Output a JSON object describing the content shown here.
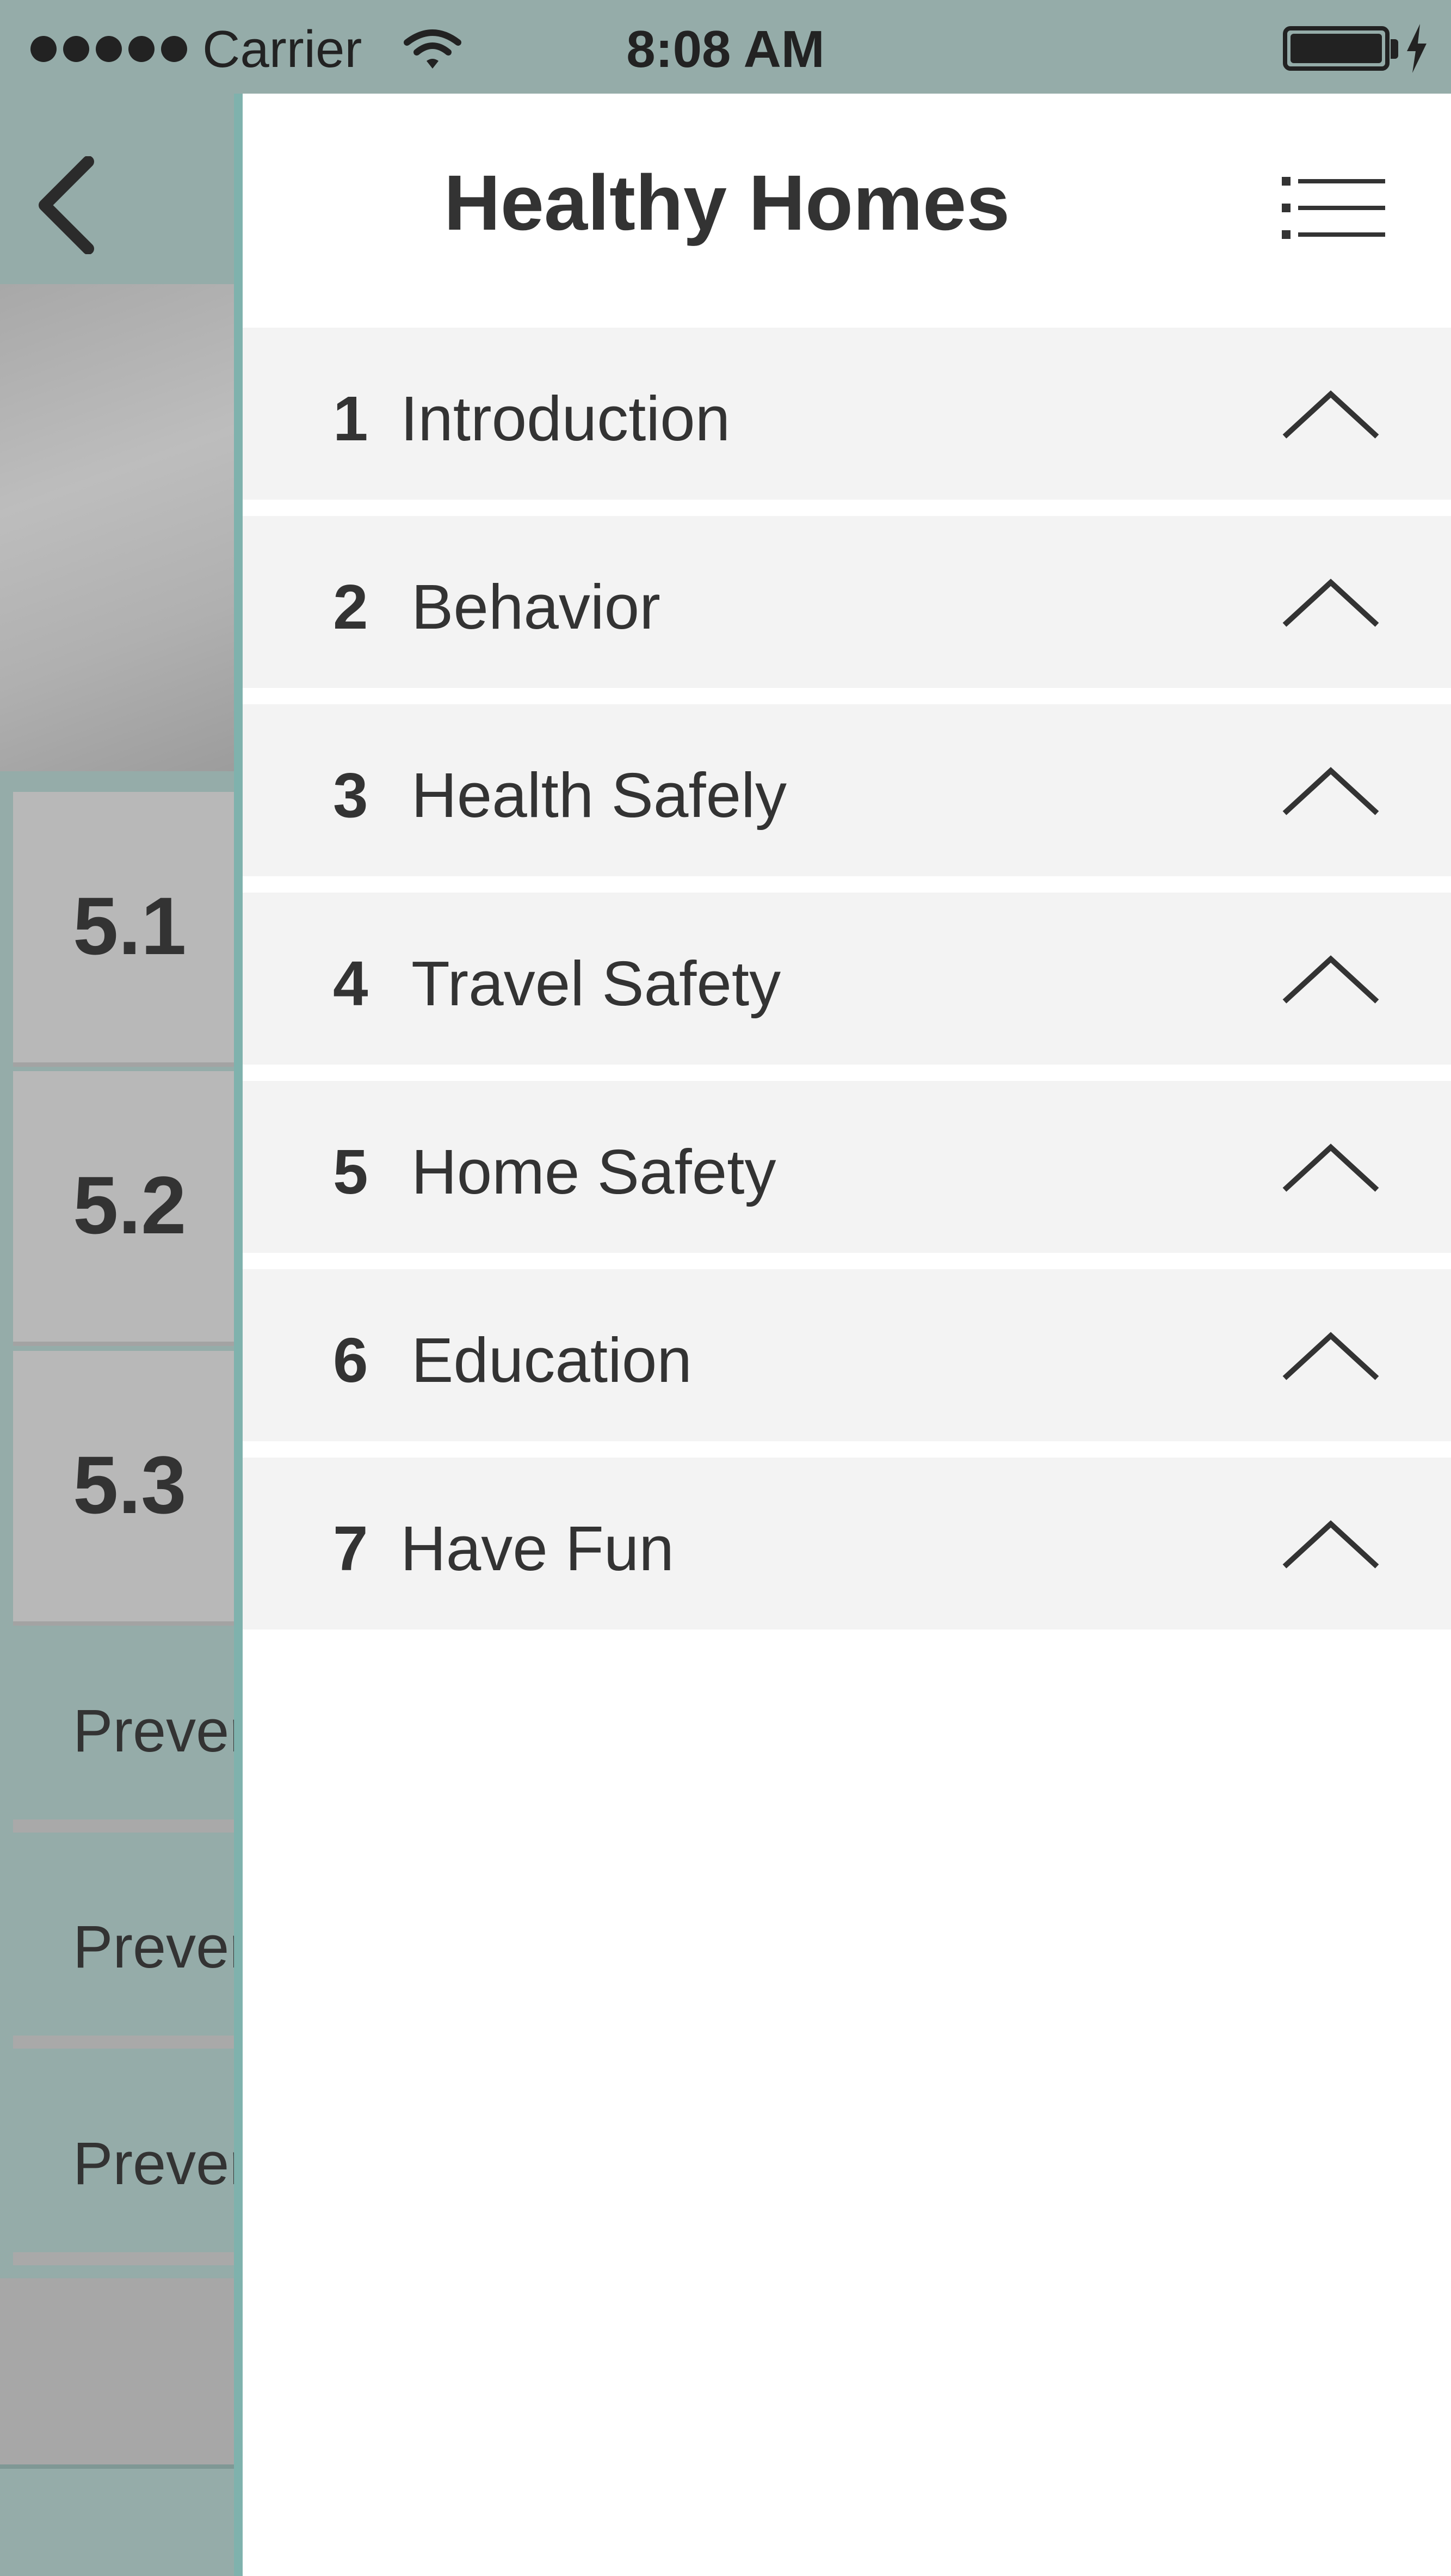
{
  "status_bar": {
    "carrier": "Carrier",
    "time": "8:08 AM"
  },
  "background_page": {
    "sections": [
      "5.1",
      "5.2",
      "5.3"
    ],
    "items": [
      "Prever",
      "Prever",
      "Prever"
    ]
  },
  "drawer": {
    "title": "Healthy Homes",
    "items": [
      {
        "number": "1",
        "label": "Introduction"
      },
      {
        "number": "2",
        "label": "Behavior"
      },
      {
        "number": "3",
        "label": "Health Safely"
      },
      {
        "number": "4",
        "label": "Travel Safety"
      },
      {
        "number": "5",
        "label": "Home Safety"
      },
      {
        "number": "6",
        "label": "Education"
      },
      {
        "number": "7",
        "label": "Have Fun"
      }
    ]
  },
  "icons": {
    "back": "chevron-left-icon",
    "menu": "list-icon",
    "item_toggle": "chevron-up-icon"
  },
  "colors": {
    "overlay_teal": "#95aca9",
    "drawer_edge": "#7fb2ad",
    "row_background": "#f3f3f3",
    "text": "#333333"
  }
}
